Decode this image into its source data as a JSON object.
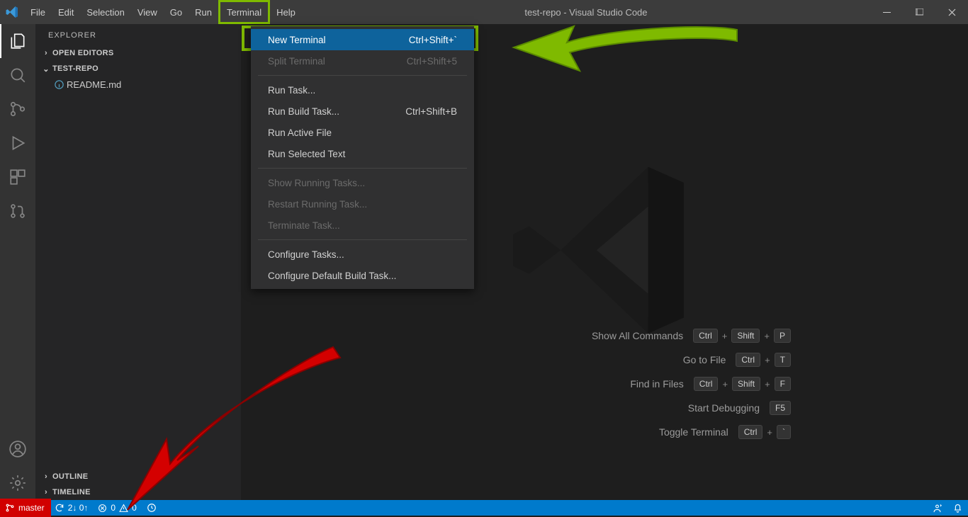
{
  "title": "test-repo - Visual Studio Code",
  "menu": {
    "file": "File",
    "edit": "Edit",
    "selection": "Selection",
    "view": "View",
    "go": "Go",
    "run": "Run",
    "terminal": "Terminal",
    "help": "Help"
  },
  "explorer": {
    "title": "EXPLORER",
    "open_editors": "OPEN EDITORS",
    "folder": "TEST-REPO",
    "file": "README.md",
    "outline": "OUTLINE",
    "timeline": "TIMELINE"
  },
  "dropdown": {
    "new_terminal": {
      "label": "New Terminal",
      "short": "Ctrl+Shift+`"
    },
    "split_terminal": {
      "label": "Split Terminal",
      "short": "Ctrl+Shift+5"
    },
    "run_task": "Run Task...",
    "run_build": {
      "label": "Run Build Task...",
      "short": "Ctrl+Shift+B"
    },
    "run_active": "Run Active File",
    "run_selected": "Run Selected Text",
    "show_running": "Show Running Tasks...",
    "restart_running": "Restart Running Task...",
    "terminate": "Terminate Task...",
    "configure": "Configure Tasks...",
    "configure_default": "Configure Default Build Task..."
  },
  "shortcuts": {
    "show_all": "Show All Commands",
    "go_file": "Go to File",
    "find_files": "Find in Files",
    "start_debug": "Start Debugging",
    "toggle_term": "Toggle Terminal",
    "k_ctrl": "Ctrl",
    "k_shift": "Shift",
    "k_p": "P",
    "k_t": "T",
    "k_f": "F",
    "k_f5": "F5",
    "k_back": "`",
    "k_plus": "+"
  },
  "status": {
    "branch": "master",
    "sync": "2↓ 0↑",
    "errors": "0",
    "warnings": "0"
  }
}
